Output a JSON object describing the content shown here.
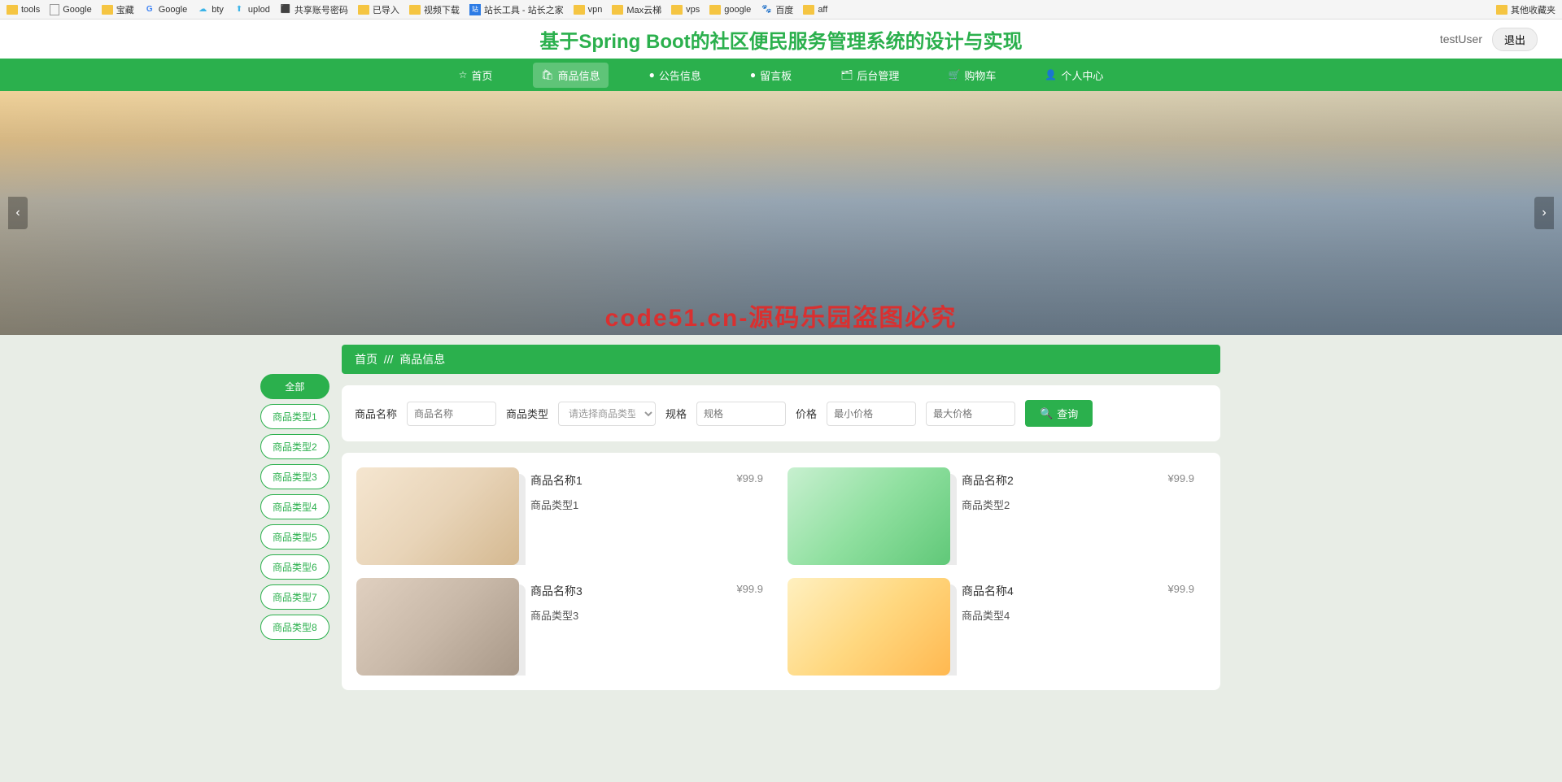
{
  "bookmarks": {
    "items": [
      {
        "label": "tools",
        "icon": "folder"
      },
      {
        "label": "Google",
        "icon": "page"
      },
      {
        "label": "宝藏",
        "icon": "folder"
      },
      {
        "label": "Google",
        "icon": "g"
      },
      {
        "label": "bty",
        "icon": "cloud"
      },
      {
        "label": "uplod",
        "icon": "up"
      },
      {
        "label": "共享账号密码",
        "icon": "share"
      },
      {
        "label": "已导入",
        "icon": "folder"
      },
      {
        "label": "视频下载",
        "icon": "folder"
      },
      {
        "label": "站长工具 - 站长之家",
        "icon": "zz"
      },
      {
        "label": "vpn",
        "icon": "folder"
      },
      {
        "label": "Max云梯",
        "icon": "folder"
      },
      {
        "label": "vps",
        "icon": "folder"
      },
      {
        "label": "google",
        "icon": "folder"
      },
      {
        "label": "百度",
        "icon": "baidu"
      },
      {
        "label": "aff",
        "icon": "folder"
      }
    ],
    "right": {
      "label": "其他收藏夹",
      "icon": "folder"
    }
  },
  "header": {
    "title": "基于Spring Boot的社区便民服务管理系统的设计与实现",
    "username": "testUser",
    "logout": "退出"
  },
  "nav": {
    "items": [
      {
        "label": "首页",
        "icon": "☆"
      },
      {
        "label": "商品信息",
        "icon": "🛍",
        "active": true
      },
      {
        "label": "公告信息",
        "icon": "●"
      },
      {
        "label": "留言板",
        "icon": "●"
      },
      {
        "label": "后台管理",
        "icon": "🗂"
      },
      {
        "label": "购物车",
        "icon": "🛒"
      },
      {
        "label": "个人中心",
        "icon": "👤"
      }
    ]
  },
  "banner": {
    "watermark": "code51.cn-源码乐园盗图必究"
  },
  "breadcrumb": {
    "home": "首页",
    "sep": "///",
    "current": "商品信息"
  },
  "categories": {
    "all": "全部",
    "items": [
      "商品类型1",
      "商品类型2",
      "商品类型3",
      "商品类型4",
      "商品类型5",
      "商品类型6",
      "商品类型7",
      "商品类型8"
    ]
  },
  "filter": {
    "name_label": "商品名称",
    "name_placeholder": "商品名称",
    "type_label": "商品类型",
    "type_placeholder": "请选择商品类型",
    "spec_label": "规格",
    "spec_placeholder": "规格",
    "price_label": "价格",
    "minprice_placeholder": "最小价格",
    "maxprice_placeholder": "最大价格",
    "search_btn": "查询"
  },
  "products": [
    {
      "name": "商品名称1",
      "type": "商品类型1",
      "price": "¥99.9",
      "img": "img1"
    },
    {
      "name": "商品名称2",
      "type": "商品类型2",
      "price": "¥99.9",
      "img": "img2"
    },
    {
      "name": "商品名称3",
      "type": "商品类型3",
      "price": "¥99.9",
      "img": "img3"
    },
    {
      "name": "商品名称4",
      "type": "商品类型4",
      "price": "¥99.9",
      "img": "img4"
    }
  ]
}
